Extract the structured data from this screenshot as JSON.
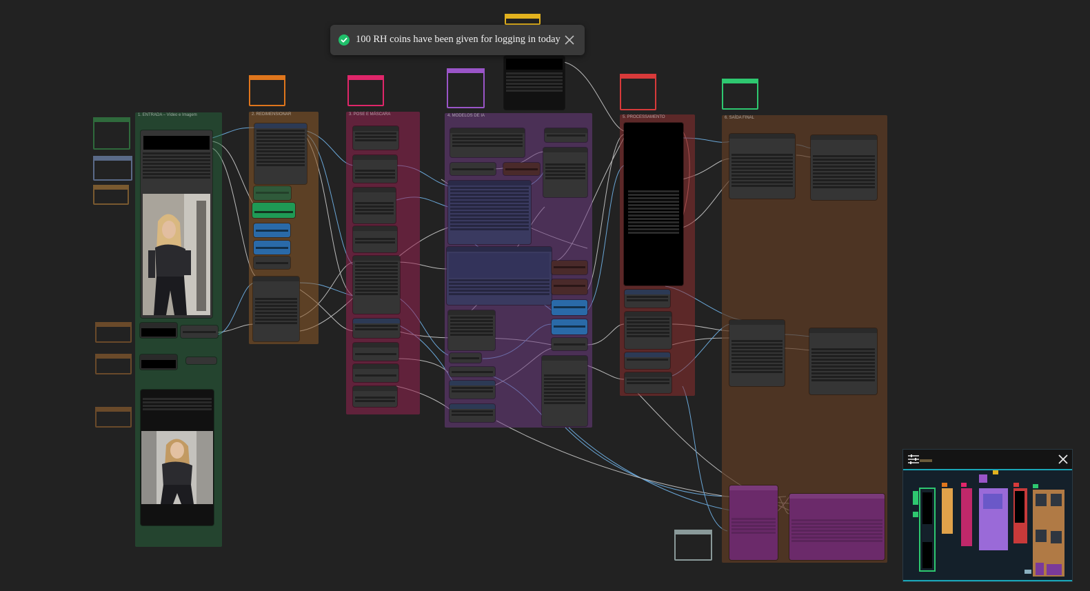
{
  "toast": {
    "message": "100 RH coins have been given for logging in today",
    "icon": "check-circle-icon",
    "close_icon": "close-icon"
  },
  "groups": [
    {
      "id": "entrada",
      "title": "1. ENTRADA – Vídeo e Imagem",
      "color": "#2f7a4a"
    },
    {
      "id": "redimensionar",
      "title": "2. REDIMENSIONAR",
      "color": "#8a5a2a"
    },
    {
      "id": "pose",
      "title": "3. POSE E MÁSCARA",
      "color": "#9a2a5a"
    },
    {
      "id": "modelos",
      "title": "4. MODELOS DE IA",
      "color": "#6a3a7a"
    },
    {
      "id": "processamento",
      "title": "5. PROCESSAMENTO",
      "color": "#8a2a2a"
    },
    {
      "id": "saida",
      "title": "6. SAÍDA FINAL",
      "color": "#5a3a24"
    }
  ],
  "minimap": {
    "settings_icon": "sliders-icon",
    "close_icon": "close-icon"
  },
  "colors": {
    "canvas_bg": "#222222",
    "toast_bg": "#3a3a3a",
    "success": "#1fbf6a",
    "minimap_accent": "#1aa6b7"
  }
}
